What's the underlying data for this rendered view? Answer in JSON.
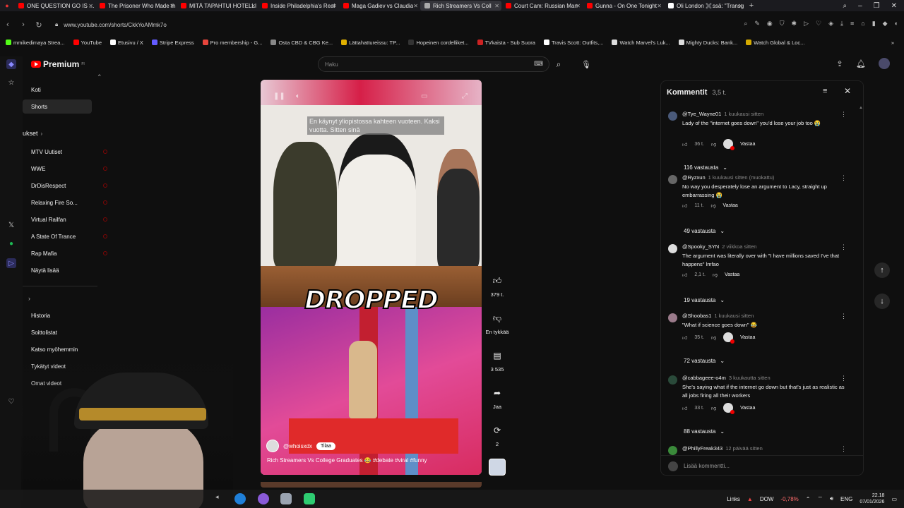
{
  "browser": {
    "tabs": [
      {
        "title": "ONE QUESTION GO IS BA",
        "color": "#ff0000",
        "active": false
      },
      {
        "title": "The Prisoner Who Made th",
        "color": "#ff0000",
        "active": false
      },
      {
        "title": "MITÄ TAPAHTUI HOTELLI",
        "color": "#ff0000",
        "active": false
      },
      {
        "title": "Inside Philadelphia's Real",
        "color": "#ff0000",
        "active": false
      },
      {
        "title": "Maga Gadiev vs Claudia",
        "color": "#ff0000",
        "active": false
      },
      {
        "title": "Rich Streamers Vs Coll",
        "color": "#aaaaaa",
        "active": true
      },
      {
        "title": "Court Cam: Russian Man",
        "color": "#ff0000",
        "active": false
      },
      {
        "title": "Gunna - On One Tonight",
        "color": "#ff0000",
        "active": false
      },
      {
        "title": "Oli London ✖️ssä: \"Transg",
        "color": "#ffffff",
        "active": false
      }
    ],
    "url": "www.youtube.com/shorts/CkkYoAMmk7o",
    "bookmarks": [
      {
        "label": "mmikedimaya Strea...",
        "color": "#53fc18"
      },
      {
        "label": "YouTube",
        "color": "#ff0000"
      },
      {
        "label": "Etusivu / X",
        "color": "#ffffff"
      },
      {
        "label": "Stripe Express",
        "color": "#635bff"
      },
      {
        "label": "Pro membership - G...",
        "color": "#e8453c"
      },
      {
        "label": "Osta CBD & CBG Ke...",
        "color": "#888888"
      },
      {
        "label": "Lättahattureissu: TP...",
        "color": "#e0b000"
      },
      {
        "label": "Hopeinen cordelliket...",
        "color": "#333333"
      },
      {
        "label": "TVkaista - Sub Suora",
        "color": "#cc2222"
      },
      {
        "label": "Travis Scott: Outfits,...",
        "color": "#ffffff"
      },
      {
        "label": "Watch Marvel's Luk...",
        "color": "#dddddd"
      },
      {
        "label": "Mighty Ducks: Bank...",
        "color": "#dddddd"
      },
      {
        "label": "Watch Global & Loc...",
        "color": "#d4aa00"
      }
    ]
  },
  "sidebar": {
    "logo": "Premium",
    "logo_sup": "FI",
    "main": [
      {
        "label": "Koti",
        "active": false
      },
      {
        "label": "Shorts",
        "active": true
      }
    ],
    "subs_header": "ukset",
    "subs": [
      {
        "label": "MTV Uutiset",
        "live": true
      },
      {
        "label": "WWE",
        "live": true
      },
      {
        "label": "DrDisRespect",
        "live": true
      },
      {
        "label": "Relaxing Fire So...",
        "live": true
      },
      {
        "label": "Virtual Railfan",
        "live": true
      },
      {
        "label": "A State Of Trance",
        "live": true
      },
      {
        "label": "Rap Mafia",
        "live": true
      },
      {
        "label": "Näytä lisää",
        "live": false
      }
    ],
    "you": [
      {
        "label": "Historia"
      },
      {
        "label": "Soittolistat"
      },
      {
        "label": "Katso myöhemmin"
      },
      {
        "label": "Tykätyt videot"
      },
      {
        "label": "Omat videot"
      }
    ]
  },
  "header": {
    "search_placeholder": "Haku"
  },
  "video": {
    "caption": "En käynyt yliopistossa kahteen vuoteen. Kaksi vuotta. Sitten sinä",
    "overlay_text": "DROPPED",
    "channel": "@whoisxdx",
    "subscribe_label": "Tilaa",
    "title": "Rich Streamers Vs College Graduates 😂 #debate #viral #funny",
    "progress": 0.0
  },
  "actions": {
    "likes": "379 t.",
    "dislike_label": "En tykkää",
    "comments": "3 535",
    "share_label": "Jaa",
    "remix": "2"
  },
  "comments": {
    "title": "Kommentit",
    "count": "3,5 t.",
    "reply_label": "Vastaa",
    "add_placeholder": "Lisää kommentti...",
    "items": [
      {
        "user": "@Tye_Wayne01",
        "time": "1 kuukausi sitten",
        "text": "Lady of the \"internet goes down\" you'd lose your job too 😭",
        "likes": "36 t.",
        "hearted": true,
        "replies": "116 vastausta",
        "avatar": "#4a5a7a"
      },
      {
        "user": "@Ryzxun",
        "time": "1 kuukausi sitten (muokattu)",
        "text": "No way you desperately lose an argument to Lacy, straight up embarrassing 😭",
        "likes": "11 t.",
        "hearted": false,
        "replies": "49 vastausta",
        "avatar": "#666666"
      },
      {
        "user": "@Spooky_SYN",
        "time": "2 viikkoa sitten",
        "text": "The argument was literally over with \"I have millions saved I've that happens\" lmfao",
        "likes": "2,1 t.",
        "hearted": false,
        "replies": "19 vastausta",
        "avatar": "#dddddd"
      },
      {
        "user": "@Shoobas1",
        "time": "1 kuukausi sitten",
        "text": "\"What if science goes down\" 😂",
        "likes": "35 t.",
        "hearted": true,
        "replies": "72 vastausta",
        "avatar": "#9a7a8a"
      },
      {
        "user": "@cabbageee-o4m",
        "time": "3 kuukautta sitten",
        "text": "She's saying what if the internet go down but that's just as realistic as all jobs firing all their workers",
        "likes": "33 t.",
        "hearted": true,
        "replies": "88 vastausta",
        "avatar": "#2a4a3a"
      },
      {
        "user": "@PhillyFreak343",
        "time": "12 päivää sitten",
        "text": "",
        "likes": "",
        "hearted": false,
        "replies": "",
        "avatar": "#3a8a3a"
      }
    ]
  },
  "taskbar": {
    "links_label": "Links",
    "ticker": "DOW",
    "ticker_change": "-0,78%",
    "lang": "ENG",
    "time": "22.18",
    "date": "07/01/2026"
  },
  "colors": {
    "accent": "#ff0000",
    "background": "#0f0f0f",
    "ticker_negative": "#ff6b6b"
  }
}
